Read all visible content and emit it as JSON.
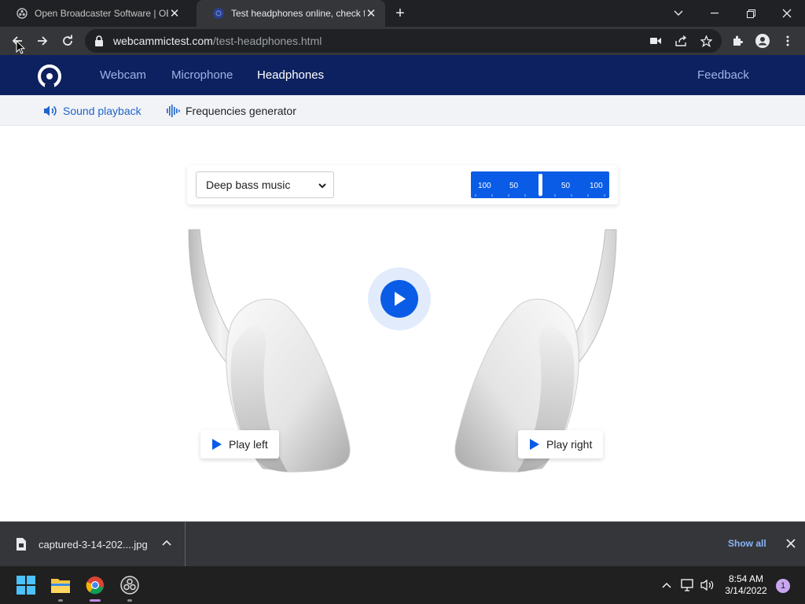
{
  "browser": {
    "tabs": [
      {
        "title": "Open Broadcaster Software | OBS",
        "icon": "obs-icon",
        "active": false
      },
      {
        "title": "Test headphones online, check fo",
        "icon": "globe-icon",
        "active": true
      }
    ],
    "url_host": "webcammictest.com",
    "url_path": "/test-headphones.html"
  },
  "site": {
    "nav": [
      "Webcam",
      "Microphone",
      "Headphones"
    ],
    "active_nav": "Headphones",
    "feedback": "Feedback",
    "subnav": {
      "sound_playback": "Sound playback",
      "frequencies_generator": "Frequencies generator"
    }
  },
  "player": {
    "track_select": "Deep bass music",
    "balance_labels": [
      "100",
      "50",
      "50",
      "100"
    ],
    "balance_value": 0.5,
    "play_left": "Play left",
    "play_right": "Play right"
  },
  "downloads": {
    "file_name": "captured-3-14-202....jpg",
    "show_all": "Show all"
  },
  "taskbar": {
    "time": "8:54 AM",
    "date": "3/14/2022",
    "notification_count": "1"
  },
  "colors": {
    "accent": "#0a5ce6",
    "nav_bg": "#0d2160",
    "nav_active": "#ffffff",
    "subnav_link": "#2064c8"
  }
}
